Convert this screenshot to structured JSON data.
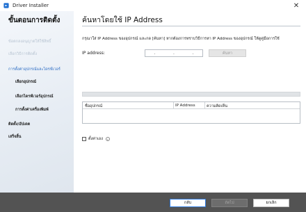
{
  "window": {
    "title": "Driver Installer",
    "close_symbol": "✕"
  },
  "sidebar": {
    "title": "ขั้นตอนการติดตั้ง",
    "steps": [
      {
        "label": "ข้อตกลงอนุญาตให้ใช้สิทธิ์",
        "state": "done"
      },
      {
        "label": "เลือกวิธีการติดตั้ง",
        "state": "done"
      },
      {
        "label": "การตั้งค่าอุปกรณ์และไดรฟ์เวอร์",
        "state": "active"
      },
      {
        "label": "เลือกอุปกรณ์",
        "state": "current-sub"
      },
      {
        "label": "เลือกไดรฟ์เวอร์อุปกรณ์",
        "state": "sub"
      },
      {
        "label": "การตั้งค่าเครื่องพิมพ์",
        "state": "sub"
      },
      {
        "label": "ติดตั้ง/อัปเดต",
        "state": "pending"
      },
      {
        "label": "เสร็จสิ้น",
        "state": "pending"
      }
    ]
  },
  "main": {
    "title": "ค้นหาโดยใช้ IP Address",
    "description": "กรุณาใส่ IP Address ของอุปกรณ์ และกด [ค้นหา] หากต้องการทราบวิธีการหา IP Address ของอุปกรณ์ ให้ดูคู่มือการใช้",
    "ip_label": "IP address:",
    "ip_separators": [
      ".",
      ".",
      "."
    ],
    "search_button": "ค้นหา",
    "progress_fraction": 0,
    "table": {
      "columns": [
        "ชื่ออุปกรณ์",
        "IP Address",
        "ความคิดเห็น"
      ]
    },
    "auto_label": "ตั้งค่าเอง",
    "auto_checked": false,
    "info_symbol": "i"
  },
  "footer": {
    "back": "กลับ",
    "next": "ถัดไป",
    "cancel": "ยกเลิก"
  },
  "colors": {
    "accent": "#2f7be0",
    "active_step": "#2b6cc4",
    "footer_bg": "#535353"
  }
}
